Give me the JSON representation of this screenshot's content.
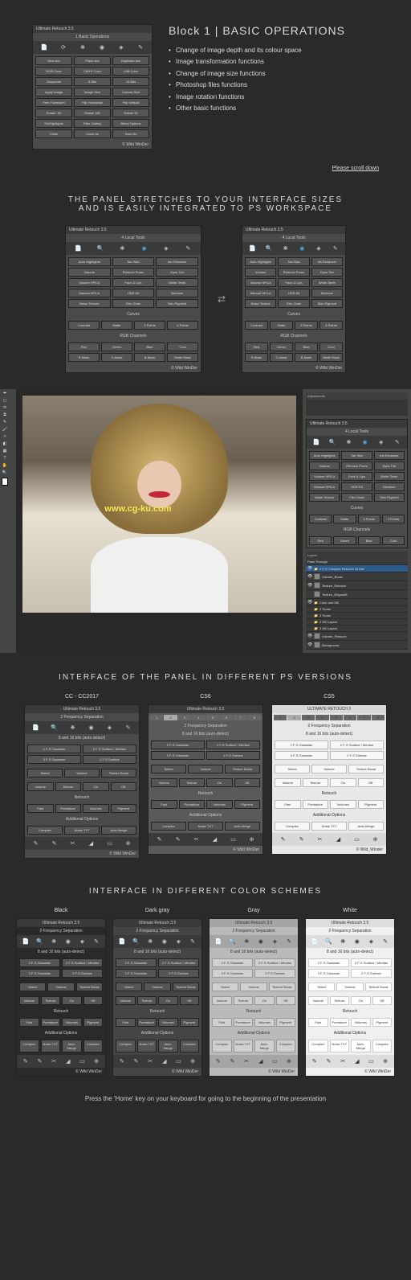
{
  "block1": {
    "heading": "Block 1 | BASIC OPERATIONS",
    "bullets": [
      "Change of image depth and its colour space",
      "Image transformation functions",
      "Change of image size functions",
      "Photoshop files functions",
      "Image rotation functions",
      "Other basic functions"
    ]
  },
  "scroll_link": "Please scroll down",
  "panel_basic": {
    "title": "Ultimate Retouch 3.5",
    "section_label": "1 Basic Operations",
    "icons": [
      "📄",
      "⟳",
      "❋",
      "◉",
      "◈",
      "✎"
    ],
    "rows": [
      [
        "New doc",
        "Place doc",
        "Duplicate doc"
      ],
      [
        "RGB Color",
        "CMYK Color",
        "LAB Color"
      ],
      [
        "Grayscale",
        "8 Bits",
        "16 Bits"
      ],
      [
        "Apply Image",
        "Image Size",
        "Canvas Size"
      ],
      [
        "Free Transform",
        "Flip Horizontal",
        "Flip Vertical"
      ],
      [
        "Rotate -90",
        "Rotate 180",
        "Rotate 90"
      ],
      [
        "Sh/Highlights",
        "Filter Gallery",
        "Blend Options"
      ],
      [
        "Close",
        "Close All",
        "Save As"
      ]
    ],
    "credit": "© Wild WinDer"
  },
  "stretch_heading_1": "THE PANEL STRETCHES TO YOUR INTERFACE SIZES",
  "stretch_heading_2": "AND IS EASILY INTEGRATED TO PS WORKSPACE",
  "panel_local": {
    "title": "Ultimate Retouch 3.5",
    "section_label": "4 Local Tools",
    "icons": [
      "📄",
      "🔍",
      "❋",
      "◉",
      "◈",
      "✎"
    ],
    "rows": [
      [
        "Auto Highlights",
        "Tan Skin",
        "Iris Enhancer"
      ],
      [
        "Volume",
        "Remove Pores",
        "Eyes Tint"
      ],
      [
        "Volume HP/LA",
        "Face & Lips",
        "White Teeth"
      ],
      [
        "Manual HP/LA",
        "HDR Kit",
        "Skintone"
      ],
      [
        "Noise Texture",
        "Film Grain",
        "Skin Pigment"
      ]
    ],
    "curves_label": "Curves",
    "curves_row": [
      "Contrast",
      "Matte",
      "3 Points",
      "4 Points"
    ],
    "rgb_label": "RGB Channels",
    "rgb_rows": [
      [
        "Red",
        "Green",
        "Blue",
        "Cool"
      ],
      [
        "R-Mask",
        "G-Mask",
        "B-Mask",
        "Matte Mask"
      ]
    ],
    "credit": "© Wild WinDer"
  },
  "ps_mockup": {
    "adjustments_label": "Adjustments",
    "layers_label": "Layers",
    "layers": [
      "2 F-S Complex Retouch 16 bits",
      "Volume_Boost",
      "Texture_Retouch",
      "Texture_ВУдалий",
      "Color and DB",
      "2 Tones",
      "3 Tones",
      "2 DB Layers",
      "3 DB Layers",
      "Volume_Retouch",
      "Background"
    ],
    "pass_through": "Pass Through",
    "watermark": "www.cg-ku.com"
  },
  "versions_heading": "INTERFACE OF THE PANEL IN DIFFERENT PS VERSIONS",
  "versions": {
    "cc": "CC - CC2017",
    "cs6": "CS6",
    "cs5": "CS5"
  },
  "panel_freq": {
    "title": "Ultimate Retouch 3.5",
    "section_label": "2 Frequency Separation",
    "sublabel": "8 and 16 bits (auto-detect)",
    "tabs": [
      "1",
      "2",
      "3",
      "4",
      "5",
      "6",
      "7",
      "8"
    ],
    "rows2": [
      [
        "2 F-S Gaussian",
        "2 F-S Surface / Median"
      ],
      [
        "3 F-S Gaussian",
        "2 F-S Surface"
      ]
    ],
    "rows3": [
      [
        "Select",
        "Volume",
        "Texture Boost"
      ],
      [
        "Volume",
        "Texture",
        "On",
        "Off"
      ]
    ],
    "retouch_label": "Retouch",
    "rows4": [
      "Fast",
      "Portraiture",
      "Volumes",
      "Pigment"
    ],
    "options_label": "Additional Options",
    "rows5": [
      "Complex",
      "Noise TXT",
      "Auto-Merge"
    ],
    "bottom_icons": [
      "✎",
      "✎",
      "✂",
      "◢",
      "▭",
      "⊕"
    ],
    "credit": "© Wild WinDer"
  },
  "panel_cs5_title": "ULTIMATE RETOUCH 3",
  "cs5_credit": "© Wild_Winder",
  "colors_heading": "INTERFACE IN DIFFERENT COLOR SCHEMES",
  "colors": {
    "black": "Black",
    "dark": "Dark gray",
    "gray": "Gray",
    "white": "White"
  },
  "footer": "Press the 'Home' key on your keyboard for going to the beginning of the presentation"
}
